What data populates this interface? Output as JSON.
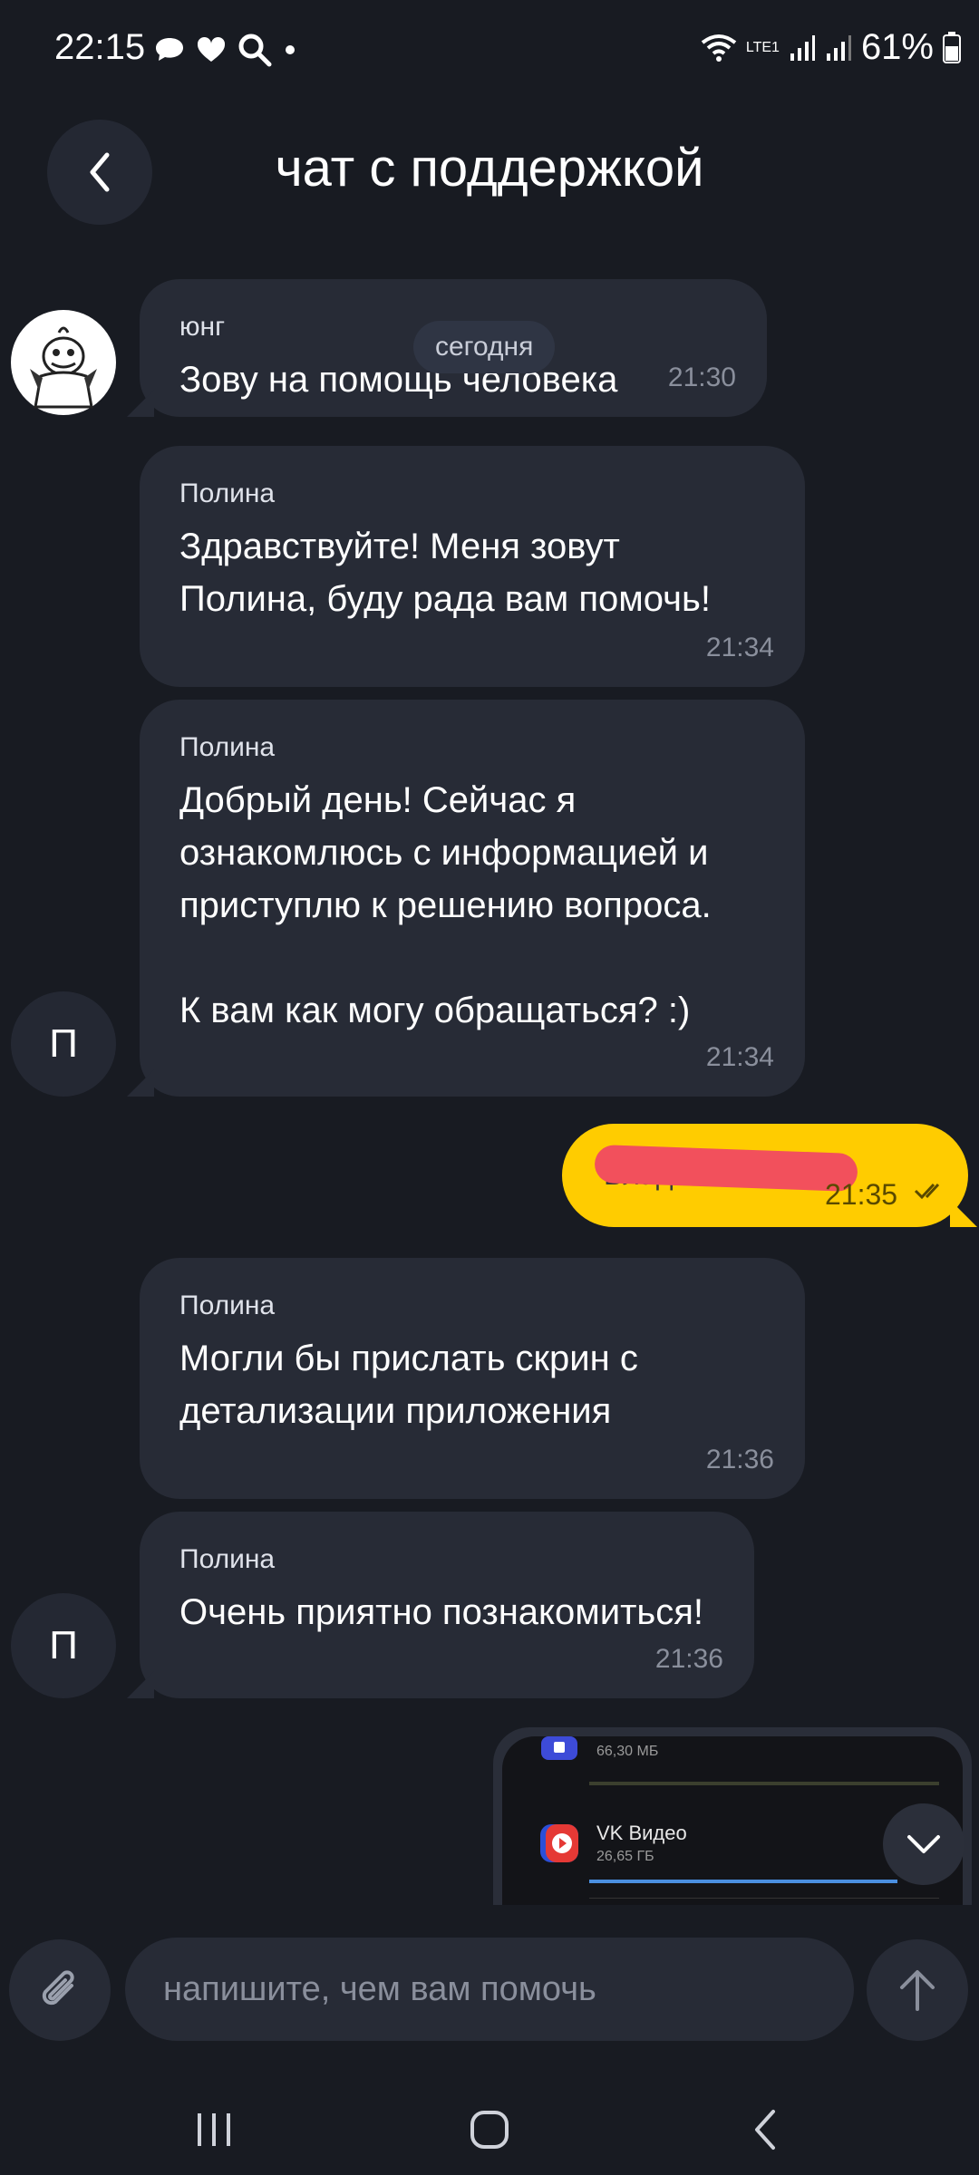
{
  "status_bar": {
    "time": "22:15",
    "battery": "61%",
    "network": "LTE1"
  },
  "header": {
    "title": "чат с поддержкой"
  },
  "date_separator": "сегодня",
  "messages": [
    {
      "sender": "юнг",
      "text": "Зову на помощь человека",
      "time": "21:30"
    },
    {
      "sender": "Полина",
      "text": "Здравствуйте! Меня зовут\nПолина, буду рада вам помочь!",
      "time": "21:34"
    },
    {
      "sender": "Полина",
      "text": "Добрый день! Сейчас я\nознакомлюсь с информацией и\nприступлю к решению вопроса.\n\nК вам как могу обращаться? :)",
      "time": "21:34"
    },
    {
      "sender": "Полина",
      "text": "Могли бы прислать скрин с\nдетализации приложения",
      "time": "21:36"
    },
    {
      "sender": "Полина",
      "text": "Очень приятно познакомиться!",
      "time": "21:36"
    }
  ],
  "my_message": {
    "text": "Влад",
    "time": "21:35"
  },
  "avatar_letter": "П",
  "attachment": {
    "row1_sub": "66,30 МБ",
    "row2_title": "VK Видео",
    "row2_sub": "26,65 ГБ"
  },
  "input": {
    "placeholder": "напишите, чем вам помочь"
  },
  "colors": {
    "background": "#181b22",
    "bubble": "#272b36",
    "accent": "#ffcc00",
    "redaction": "#f2505c"
  }
}
